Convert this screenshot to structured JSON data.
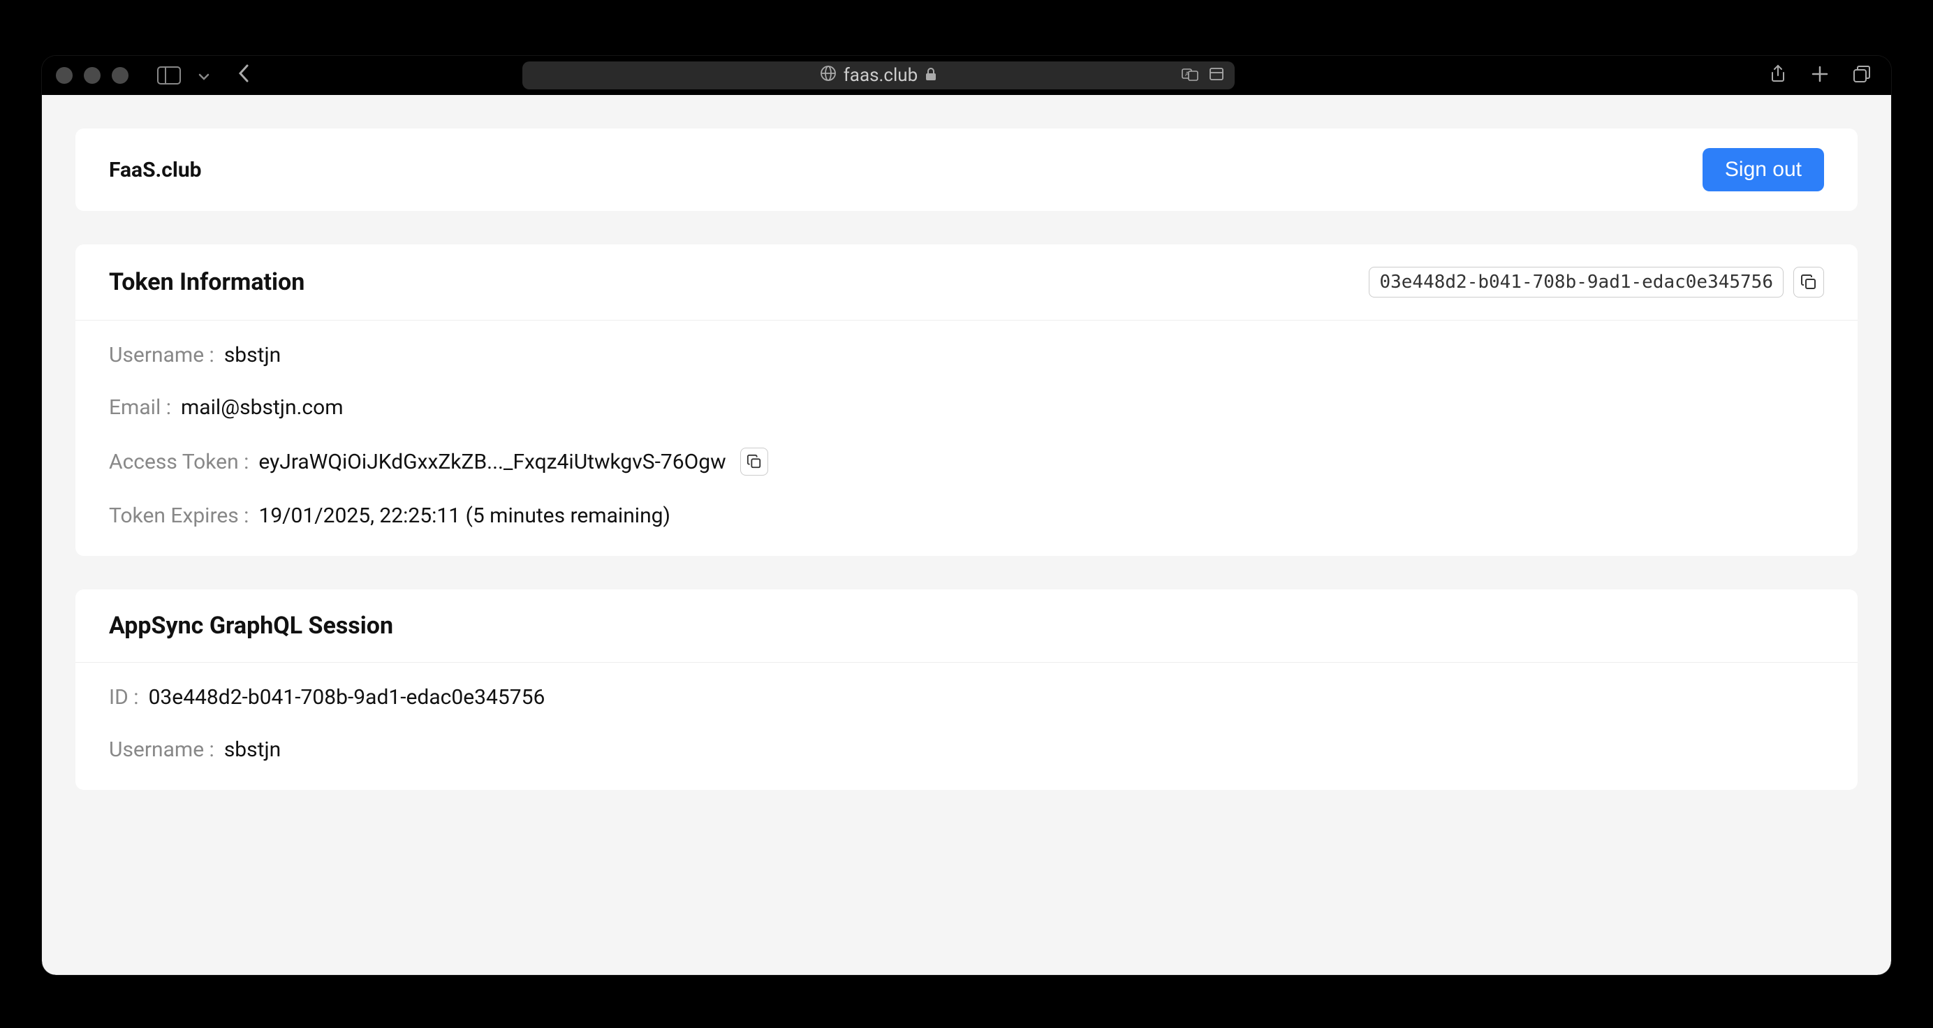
{
  "browser": {
    "url": "faas.club"
  },
  "header": {
    "title": "FaaS.club",
    "signout_label": "Sign out"
  },
  "token_card": {
    "title": "Token Information",
    "token_id": "03e448d2-b041-708b-9ad1-edac0e345756",
    "fields": {
      "username_label": "Username :",
      "username_value": "sbstjn",
      "email_label": "Email :",
      "email_value": "mail@sbstjn.com",
      "access_token_label": "Access Token :",
      "access_token_value": "eyJraWQiOiJKdGxxZkZB..._Fxqz4iUtwkgvS-76Ogw",
      "token_expires_label": "Token Expires :",
      "token_expires_value": "19/01/2025, 22:25:11 (5 minutes remaining)"
    }
  },
  "session_card": {
    "title": "AppSync GraphQL Session",
    "fields": {
      "id_label": "ID :",
      "id_value": "03e448d2-b041-708b-9ad1-edac0e345756",
      "username_label": "Username :",
      "username_value": "sbstjn"
    }
  }
}
